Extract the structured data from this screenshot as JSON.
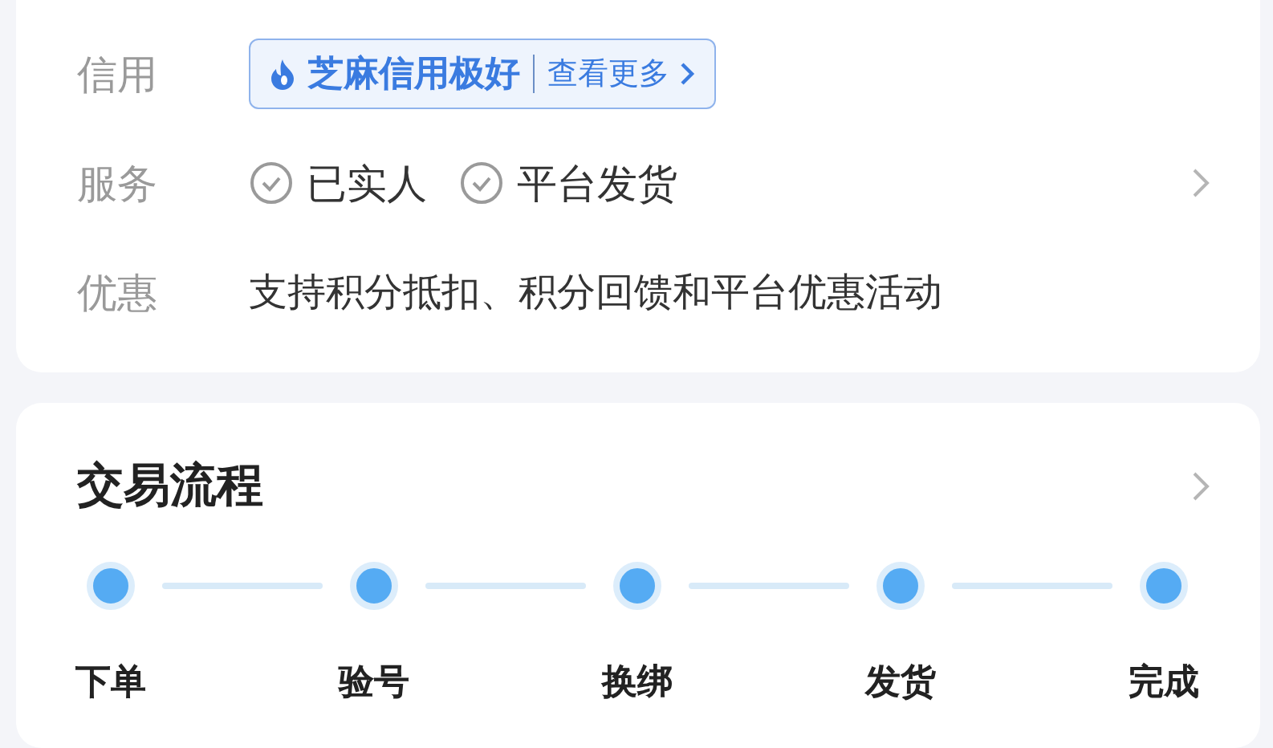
{
  "info_rows": [
    {
      "kind": "credit",
      "label": "信用",
      "badge": {
        "text": "芝麻信用极好",
        "link": "查看更多"
      }
    },
    {
      "kind": "services",
      "label": "服务",
      "items": [
        "已实人",
        "平台发货"
      ]
    },
    {
      "kind": "text",
      "label": "优惠",
      "text": "支持积分抵扣、积分回馈和平台优惠活动"
    }
  ],
  "process": {
    "title": "交易流程",
    "steps": [
      "下单",
      "验号",
      "换绑",
      "发货",
      "完成"
    ]
  }
}
